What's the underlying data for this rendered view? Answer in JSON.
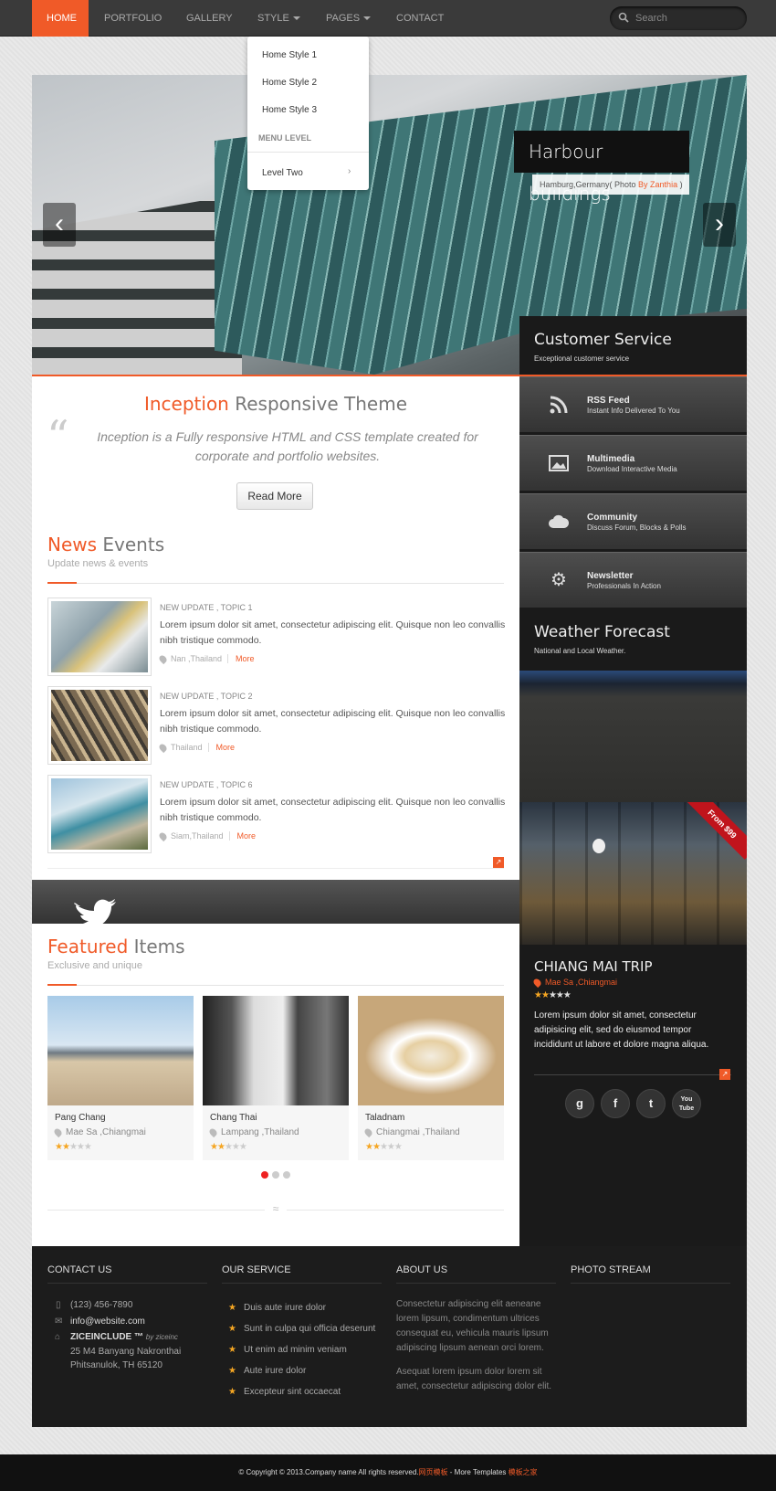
{
  "nav": {
    "items": [
      "HOME",
      "PORTFOLIO",
      "GALLERY",
      "STYLE",
      "PAGES",
      "CONTACT"
    ],
    "search_placeholder": "Search",
    "dropdown": {
      "items": [
        "Home Style 1",
        "Home Style 2",
        "Home Style 3"
      ],
      "header": "MENU LEVEL",
      "level_two": "Level Two",
      "level_two_arrow": "›"
    }
  },
  "hero": {
    "caption": "Harbour buildings",
    "subcaption_prefix": "Hamburg,Germany( Photo ",
    "subcaption_by": "By Zanthia",
    "subcaption_suffix": " )",
    "prev": "‹",
    "next": "›"
  },
  "intro": {
    "title_accent": "Inception",
    "title_rest": " Responsive Theme",
    "quote_mark": "“",
    "text": "Inception is a Fully responsive HTML and CSS template created for corporate and portfolio websites.",
    "button": "Read More"
  },
  "news": {
    "title_accent": "News",
    "title_rest": " Events",
    "subtitle": "Update news & events",
    "items": [
      {
        "tag": "NEW UPDATE , TOPIC 1",
        "body": "Lorem ipsum dolor sit amet, consectetur adipiscing elit. Quisque non leo convallis nibh tristique commodo.",
        "loc": "Nan ,Thailand",
        "more": "More"
      },
      {
        "tag": "NEW UPDATE , TOPIC 2",
        "body": "Lorem ipsum dolor sit amet, consectetur adipiscing elit. Quisque non leo convallis nibh tristique commodo.",
        "loc": "Thailand",
        "more": "More"
      },
      {
        "tag": "NEW UPDATE , TOPIC 6",
        "body": "Lorem ipsum dolor sit amet, consectetur adipiscing elit. Quisque non leo convallis nibh tristique commodo.",
        "loc": "Siam,Thailand",
        "more": "More"
      }
    ]
  },
  "featured": {
    "title_accent": "Featured",
    "title_rest": " Items",
    "subtitle": "Exclusive and unique",
    "items": [
      {
        "title": "Pang Chang",
        "loc": "Mae Sa ,Chiangmai",
        "rating": 2
      },
      {
        "title": "Chang Thai",
        "loc": "Lampang ,Thailand",
        "rating": 2
      },
      {
        "title": "Taladnam",
        "loc": "Chiangmai ,Thailand",
        "rating": 2
      }
    ]
  },
  "sidebar": {
    "cs_title": "Customer Service",
    "cs_sub": "Exceptional customer service",
    "services": [
      {
        "icon": "rss-icon",
        "title": "RSS Feed",
        "sub": "Instant Info Delivered To You"
      },
      {
        "icon": "image-icon",
        "title": "Multimedia",
        "sub": "Download Interactive Media"
      },
      {
        "icon": "cloud-icon",
        "title": "Community",
        "sub": "Discuss Forum, Blocks & Polls"
      },
      {
        "icon": "gear-icon",
        "title": "Newsletter",
        "sub": "Professionals In Action"
      }
    ],
    "wf_title": "Weather Forecast",
    "wf_sub": "National and Local Weather.",
    "ribbon": "From $99",
    "trip_title": "CHIANG MAI TRIP",
    "trip_loc": "Mae Sa ,Chiangmai",
    "trip_rating": 2,
    "trip_body": "Lorem ipsum dolor sit amet, consectetur adipisicing elit, sed do eiusmod tempor incididunt ut labore et dolore magna aliqua.",
    "social": [
      "g",
      "f",
      "t",
      "You Tube"
    ]
  },
  "footer": {
    "contact": {
      "title": "CONTACT US",
      "phone": "(123) 456-7890",
      "email": "info@website.com",
      "company": "ZICEINCLUDE ™",
      "company_by": "by ziceinc",
      "address1": "25 M4 Banyang Nakronthai",
      "address2": "Phitsanulok, TH 65120"
    },
    "service": {
      "title": "OUR SERVICE",
      "items": [
        "Duis aute irure dolor",
        "Sunt in culpa qui officia deserunt",
        "Ut enim ad minim veniam",
        "Aute irure dolor",
        "Excepteur sint occaecat"
      ]
    },
    "about": {
      "title": "ABOUT US",
      "p1": "Consectetur adipiscing elit aeneane lorem lipsum, condimentum ultrices consequat eu, vehicula mauris lipsum adipiscing lipsum aenean orci lorem.",
      "p2": "Asequat lorem ipsum dolor lorem sit amet, consectetur adipiscing dolor elit."
    },
    "photo": {
      "title": "PHOTO STREAM"
    },
    "copyright": "© Copyright © 2013.Company name All rights reserved.",
    "copy_r1": "网页模板",
    "copy_mid": " - More Templates ",
    "copy_r2": "模板之家"
  },
  "colors": {
    "accent": "#f05a28",
    "dark": "#1a1a1a",
    "ribbon": "#c0141c"
  }
}
